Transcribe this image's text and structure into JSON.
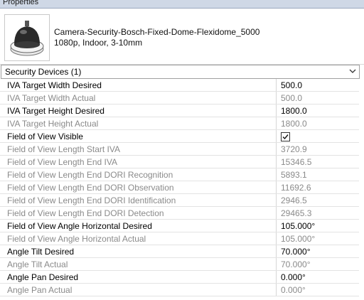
{
  "panel": {
    "title": "Properties"
  },
  "type": {
    "name": "Camera-Security-Bosch-Fixed-Dome-Flexidome_5000",
    "subtitle": "1080p, Indoor, 3-10mm",
    "thumbnail_icon": "dome-camera-icon"
  },
  "selector": {
    "label": "Security Devices (1)"
  },
  "properties": [
    {
      "name": "IVA Target Width Desired",
      "value": "500.0",
      "editable": true
    },
    {
      "name": "IVA Target Width Actual",
      "value": "500.0",
      "editable": false
    },
    {
      "name": "IVA Target Height Desired",
      "value": "1800.0",
      "editable": true
    },
    {
      "name": "IVA Target Height Actual",
      "value": "1800.0",
      "editable": false
    },
    {
      "name": "Field of View Visible",
      "value": "",
      "editable": true,
      "checkbox": true,
      "checked": true
    },
    {
      "name": "Field of View Length Start IVA",
      "value": "3720.9",
      "editable": false
    },
    {
      "name": "Field of View Length End IVA",
      "value": "15346.5",
      "editable": false
    },
    {
      "name": "Field of View Length End DORI Recognition",
      "value": "5893.1",
      "editable": false
    },
    {
      "name": "Field of View Length End DORI Observation",
      "value": "11692.6",
      "editable": false
    },
    {
      "name": "Field of View Length End DORI Identification",
      "value": "2946.5",
      "editable": false
    },
    {
      "name": "Field of View Length End DORI Detection",
      "value": "29465.3",
      "editable": false
    },
    {
      "name": "Field of View Angle Horizontal Desired",
      "value": "105.000°",
      "editable": true
    },
    {
      "name": "Field of View Angle Horizontal Actual",
      "value": "105.000°",
      "editable": false
    },
    {
      "name": "Angle Tilt Desired",
      "value": "70.000°",
      "editable": true
    },
    {
      "name": "Angle Tilt Actual",
      "value": "70.000°",
      "editable": false
    },
    {
      "name": "Angle Pan Desired",
      "value": "0.000°",
      "editable": true
    },
    {
      "name": "Angle Pan Actual",
      "value": "0.000°",
      "editable": false
    }
  ]
}
